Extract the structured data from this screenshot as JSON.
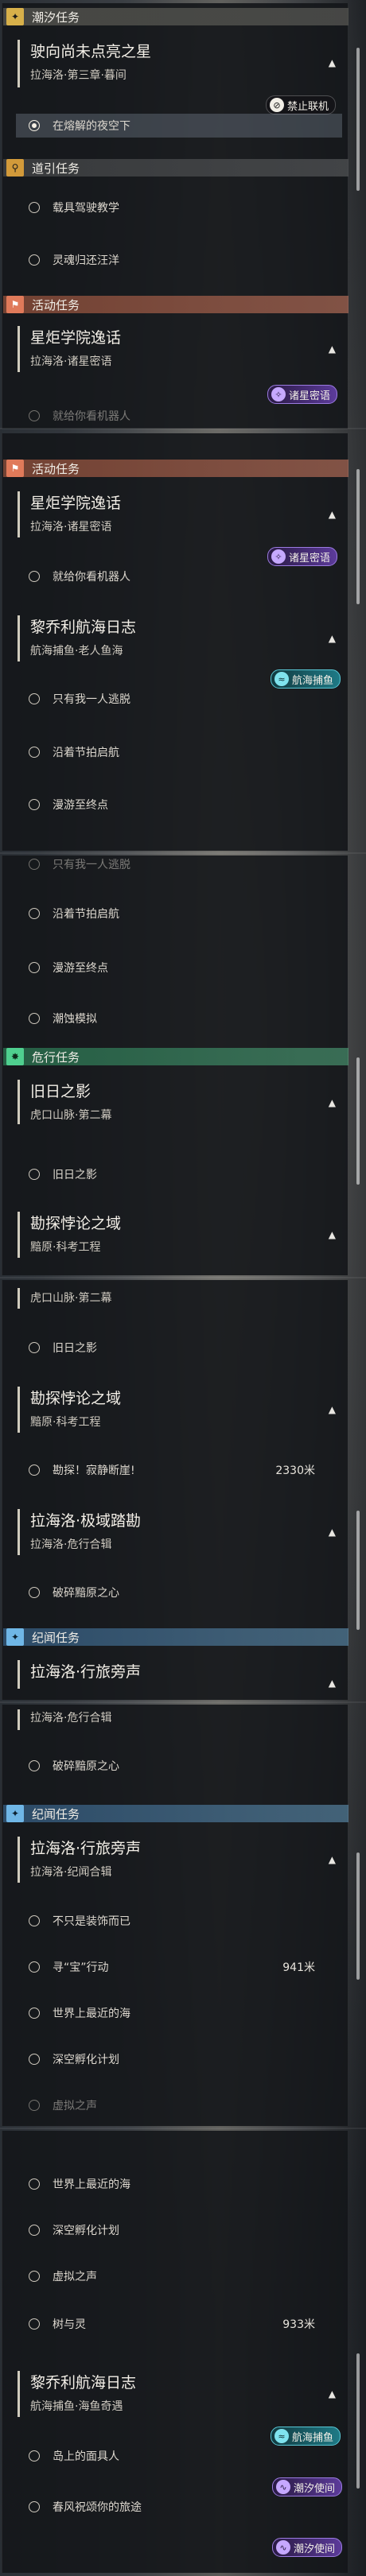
{
  "categories": {
    "tide": "潮汐任务",
    "guide": "道引任务",
    "activity": "活动任务",
    "danger": "危行任务",
    "discipline": "纪闻任务"
  },
  "s1": {
    "q1_title": "驶向尚未点亮之星",
    "q1_sub": "拉海洛·第三章·暮间",
    "q1_tag": "禁止联机",
    "q1_item": "在熔解的夜空下",
    "g1": "载具驾驶教学",
    "g2": "灵魂归还汪洋",
    "a_title": "星炬学院逸话",
    "a_sub": "拉海洛·诸星密语",
    "a_tag": "诸星密语",
    "a_clip": "就给你看机器人"
  },
  "s2": {
    "a_title": "星炬学院逸话",
    "a_sub": "拉海洛·诸星密语",
    "a_tag": "诸星密语",
    "a_item": "就给你看机器人",
    "b_title": "黎乔利航海日志",
    "b_sub": "航海捕鱼·老人鱼海",
    "b_tag": "航海捕鱼",
    "b1": "只有我一人逃脱",
    "b2": "沿着节拍启航",
    "b3": "漫游至终点"
  },
  "s3": {
    "clip": "只有我一人逃脱",
    "b2": "沿着节拍启航",
    "b3": "漫游至终点",
    "b4": "潮蚀模拟",
    "d1_title": "旧日之影",
    "d1_sub": "虎口山脉·第二幕",
    "d1_item": "旧日之影",
    "d2_title": "勘探悖论之域",
    "d2_sub": "黯原·科考工程"
  },
  "s4": {
    "clip": "虎口山脉·第二幕",
    "d1_item": "旧日之影",
    "d2_title": "勘探悖论之域",
    "d2_sub": "黯原·科考工程",
    "d2_item": "勘探！寂静断崖!",
    "d2_dist": "2330米",
    "d3_title": "拉海洛·极域踏勘",
    "d3_sub": "拉海洛·危行合辑",
    "d3_item": "破碎黯原之心",
    "j_title": "拉海洛·行旅旁声"
  },
  "s5": {
    "clip": "拉海洛·危行合辑",
    "d3_item": "破碎黯原之心",
    "j_title": "拉海洛·行旅旁声",
    "j_sub": "拉海洛·纪闻合辑",
    "j1": "不只是装饰而已",
    "j2": "寻“宝”行动",
    "j2_dist": "941米",
    "j3": "世界上最近的海",
    "j4": "深空孵化计划",
    "j5_clip": "虚拟之声"
  },
  "s6": {
    "j3": "世界上最近的海",
    "j4": "深空孵化计划",
    "j5": "虚拟之声",
    "j6": "树与灵",
    "j6_dist": "933米",
    "l_title": "黎乔利航海日志",
    "l_sub": "航海捕鱼·海鱼奇遇",
    "l_tag": "航海捕鱼",
    "l1": "岛上的面具人",
    "l_tag2": "潮汐使间",
    "l2": "春风祝颂你的旅途",
    "l_tag3": "潮汐使间"
  }
}
